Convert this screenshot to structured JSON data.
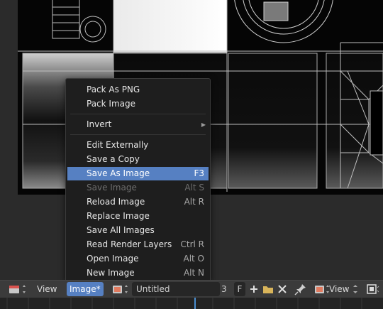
{
  "menu": {
    "items": [
      {
        "label": "Pack As PNG",
        "shortcut": "",
        "disabled": false,
        "highlighted": false,
        "submenu": false
      },
      {
        "label": "Pack Image",
        "shortcut": "",
        "disabled": false,
        "highlighted": false,
        "submenu": false
      },
      {
        "label": "Invert",
        "shortcut": "",
        "disabled": false,
        "highlighted": false,
        "submenu": true
      },
      {
        "label": "Edit Externally",
        "shortcut": "",
        "disabled": false,
        "highlighted": false,
        "submenu": false
      },
      {
        "label": "Save a Copy",
        "shortcut": "",
        "disabled": false,
        "highlighted": false,
        "submenu": false
      },
      {
        "label": "Save As Image",
        "shortcut": "F3",
        "disabled": false,
        "highlighted": true,
        "submenu": false
      },
      {
        "label": "Save Image",
        "shortcut": "Alt S",
        "disabled": true,
        "highlighted": false,
        "submenu": false
      },
      {
        "label": "Reload Image",
        "shortcut": "Alt R",
        "disabled": false,
        "highlighted": false,
        "submenu": false
      },
      {
        "label": "Replace Image",
        "shortcut": "",
        "disabled": false,
        "highlighted": false,
        "submenu": false
      },
      {
        "label": "Save All Images",
        "shortcut": "",
        "disabled": false,
        "highlighted": false,
        "submenu": false
      },
      {
        "label": "Read Render Layers",
        "shortcut": "Ctrl R",
        "disabled": false,
        "highlighted": false,
        "submenu": false
      },
      {
        "label": "Open Image",
        "shortcut": "Alt O",
        "disabled": false,
        "highlighted": false,
        "submenu": false
      },
      {
        "label": "New Image",
        "shortcut": "Alt N",
        "disabled": false,
        "highlighted": false,
        "submenu": false
      }
    ]
  },
  "header": {
    "view_label": "View",
    "image_menu_label": "Image*",
    "image_name": "Untitled",
    "users_count": "3",
    "fake_user_label": "F",
    "view2_label": "View"
  },
  "icons": {
    "editor_type": "image-editor-icon",
    "browse_image": "image-browse-icon",
    "new": "plus-icon",
    "open": "folder-icon",
    "unlink": "x-icon",
    "pin": "pin-icon",
    "display_channels": "display-icon",
    "frame_view": "frame-icon"
  },
  "colors": {
    "highlight": "#5680c2",
    "menu_bg": "#1e1e1e",
    "header_bg": "#3b3b3b",
    "playhead": "#4b8fd1"
  }
}
